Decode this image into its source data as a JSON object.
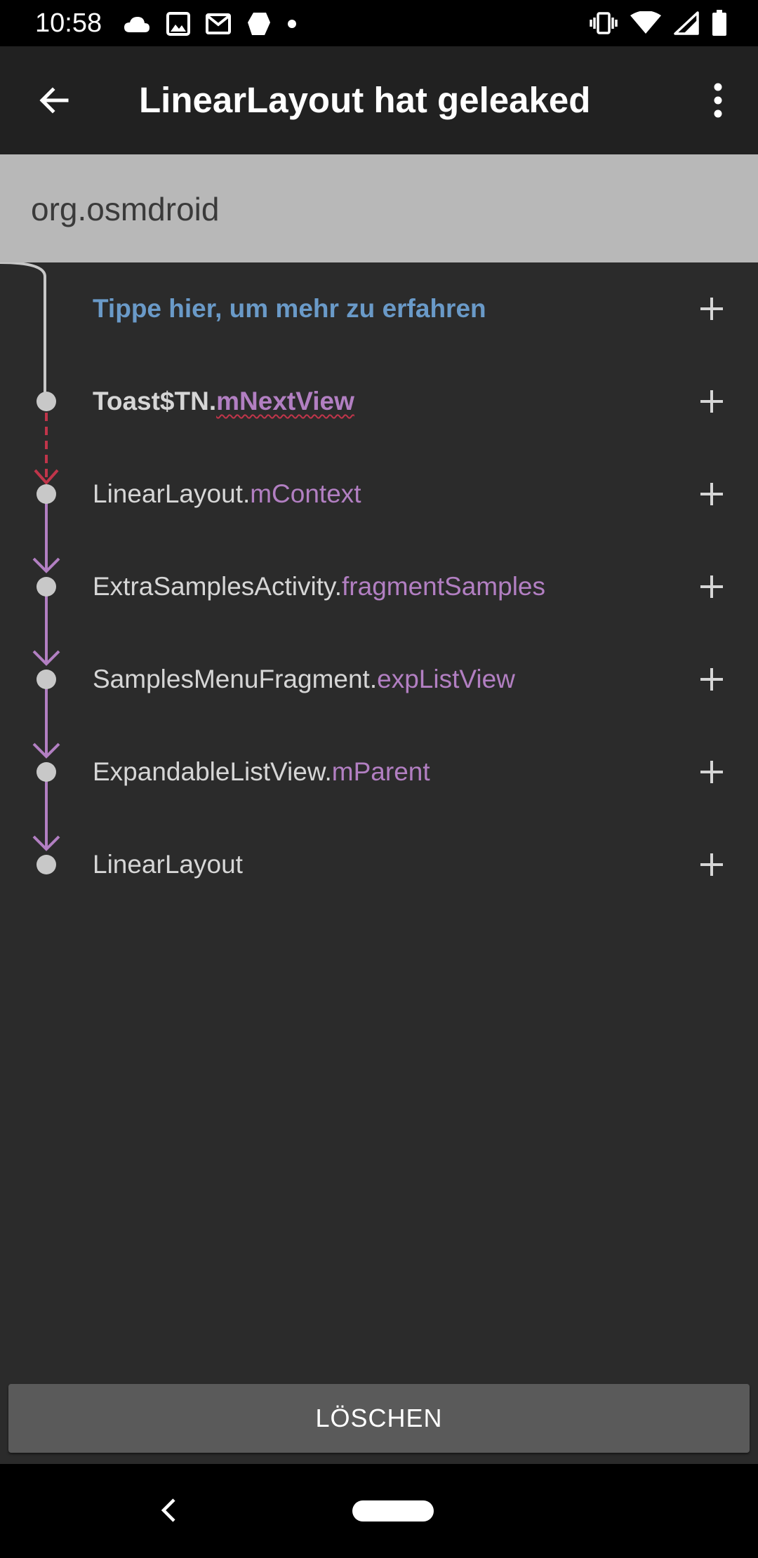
{
  "status_bar": {
    "time": "10:58",
    "left_icons": [
      "cloud-icon",
      "image-icon",
      "gmail-icon",
      "shield-app-icon",
      "dot-icon"
    ],
    "right_icons": [
      "vibrate-icon",
      "wifi-icon",
      "cell-signal-icon",
      "battery-icon"
    ]
  },
  "toolbar": {
    "title": "LinearLayout hat geleaked",
    "back_icon": "arrow-back-icon",
    "overflow_icon": "more-vert-icon"
  },
  "package": {
    "name": "org.osmdroid"
  },
  "trace": {
    "hint": "Tippe hier, um mehr zu erfahren",
    "rows": [
      {
        "cls": "Toast$TN.",
        "field": "mNextView"
      },
      {
        "cls": "LinearLayout.",
        "field": "mContext"
      },
      {
        "cls": "ExtraSamplesActivity.",
        "field": "fragmentSamples"
      },
      {
        "cls": "SamplesMenuFragment.",
        "field": "expListView"
      },
      {
        "cls": "ExpandableListView.",
        "field": "mParent"
      },
      {
        "cls": "LinearLayout",
        "field": ""
      }
    ]
  },
  "actions": {
    "clear_label": "LÖSCHEN"
  },
  "colors": {
    "field": "#b27fc2",
    "hint": "#6a9ac8",
    "leak": "#c0354a",
    "node": "#c8c8c8",
    "package_bg": "#b8b8b8",
    "toolbar_bg": "#212121",
    "background": "#2b2b2b"
  }
}
